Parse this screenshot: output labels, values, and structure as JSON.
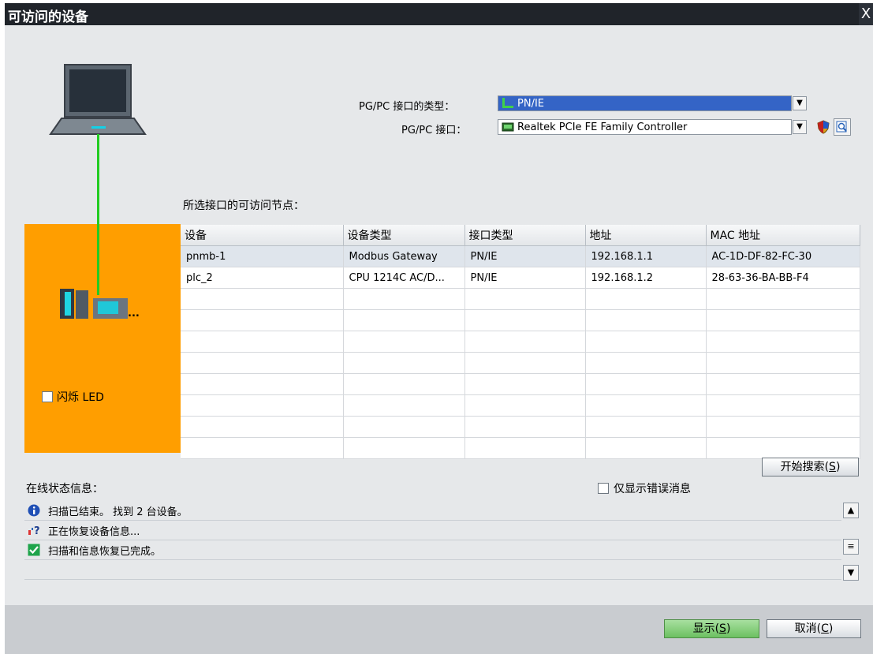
{
  "window": {
    "title": "可访问的设备",
    "close_glyph": "X"
  },
  "interface": {
    "type_label": "PG/PC 接口的类型：",
    "type_value": "PN/IE",
    "iface_label": "PG/PC 接口：",
    "iface_value": "Realtek PCIe FE Family Controller"
  },
  "nodes_label": "所选接口的可访问节点：",
  "table": {
    "headers": [
      "设备",
      "设备类型",
      "接口类型",
      "地址",
      "MAC 地址"
    ],
    "rows": [
      [
        "pnmb-1",
        "Modbus Gateway",
        "PN/IE",
        "192.168.1.1",
        "AC-1D-DF-82-FC-30"
      ],
      [
        "plc_2",
        "CPU 1214C AC/D...",
        "PN/IE",
        "192.168.1.2",
        "28-63-36-BA-BB-F4"
      ]
    ]
  },
  "flash_led_label": "闪烁 LED",
  "device_ellipsis": "...",
  "search_button": {
    "text": "开始搜索(",
    "mnemonic": "S",
    "tail": ")"
  },
  "status": {
    "title": "在线状态信息：",
    "only_errors_label": "仅显示错误消息",
    "messages": [
      "扫描已结束。 找到 2 台设备。",
      "正在恢复设备信息...",
      "扫描和信息恢复已完成。"
    ]
  },
  "buttons": {
    "show": {
      "text": "显示(",
      "mnemonic": "S",
      "tail": ")"
    },
    "cancel": {
      "text": "取消(",
      "mnemonic": "C",
      "tail": ")"
    }
  },
  "colors": {
    "accent_orange": "#ff9e00",
    "selection_blue": "#3464c6",
    "link_green": "#22cc22",
    "titlebar": "#20242a"
  }
}
